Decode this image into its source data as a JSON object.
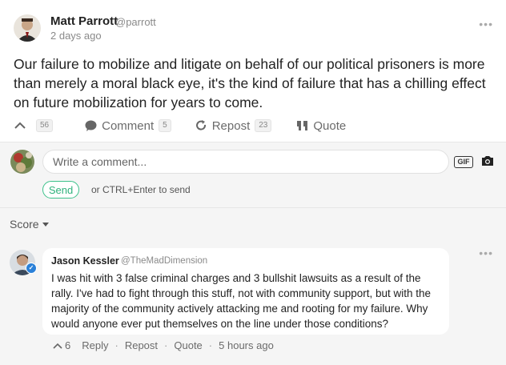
{
  "post": {
    "author": "Matt Parrott",
    "handle": "@parrott",
    "time": "2 days ago",
    "text": "Our failure to mobilize and litigate on behalf of our political prisoners is more than merely a moral black eye, it's the kind of failure that has a chilling effect on future mobilization for years to come.",
    "more": "•••",
    "actions": {
      "upvote_count": "56",
      "comment_label": "Comment",
      "comment_count": "5",
      "repost_label": "Repost",
      "repost_count": "23",
      "quote_label": "Quote"
    }
  },
  "composer": {
    "placeholder": "Write a comment...",
    "gif_label": "GIF",
    "send_label": "Send",
    "hint": "or CTRL+Enter to send"
  },
  "sort": {
    "label": "Score"
  },
  "reply": {
    "author": "Jason Kessler",
    "handle": "@TheMadDimension",
    "text": "I was hit with 3 false criminal charges and 3 bullshit lawsuits as a result of the rally. I've had to fight through this stuff, not with community support, but with the majority of the community actively attacking me and rooting for my failure. Why would anyone ever put themselves on the line under those conditions?",
    "more": "•••",
    "upvote_count": "6",
    "reply_label": "Reply",
    "repost_label": "Repost",
    "quote_label": "Quote",
    "time": "5 hours ago",
    "sep": "·"
  },
  "colors": {
    "accent_green": "#3cc18a",
    "verified_blue": "#2a80d8",
    "muted": "#8a8a8a"
  }
}
